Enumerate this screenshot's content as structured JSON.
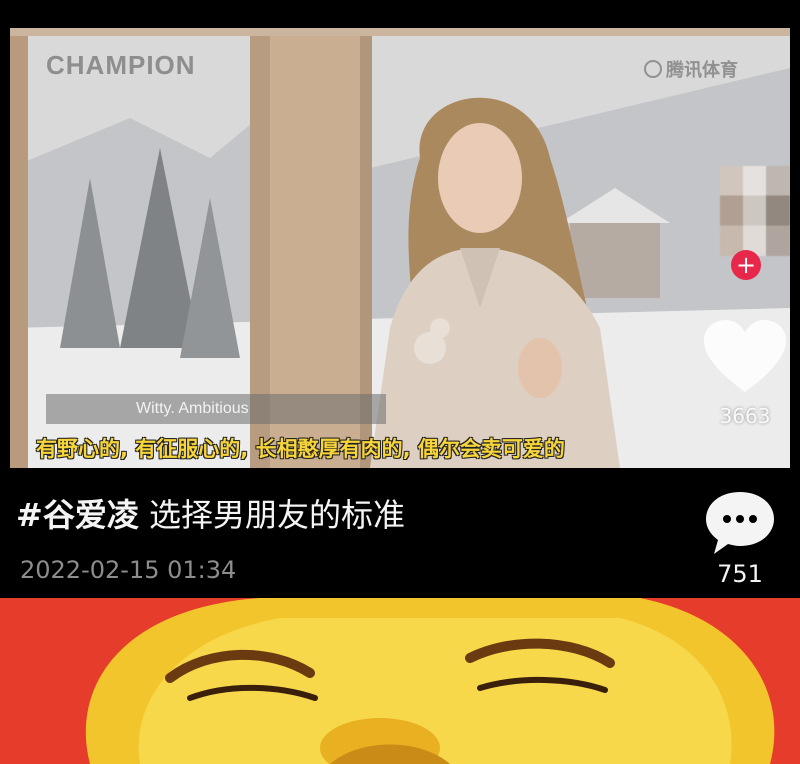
{
  "video": {
    "brand_logo": "CHAMPION",
    "watermark": "腾讯体育",
    "lower_third": "Witty. Ambitious",
    "subtitle": "有野心的, 有征服心的, 长相憨厚有肉的, 偶尔会卖可爱的",
    "follow_label": "+",
    "like_count": "3663"
  },
  "post": {
    "hashtag": "#谷爱凌",
    "title": "选择男朋友的标准",
    "timestamp": "2022-02-15 01:34",
    "comment_count": "751"
  },
  "colors": {
    "page_background": "#000000",
    "subtitle_yellow": "#f6d43a",
    "follow_red": "#e8284a",
    "meme_red": "#e63c2b",
    "meme_yellow": "#f2c52c"
  }
}
